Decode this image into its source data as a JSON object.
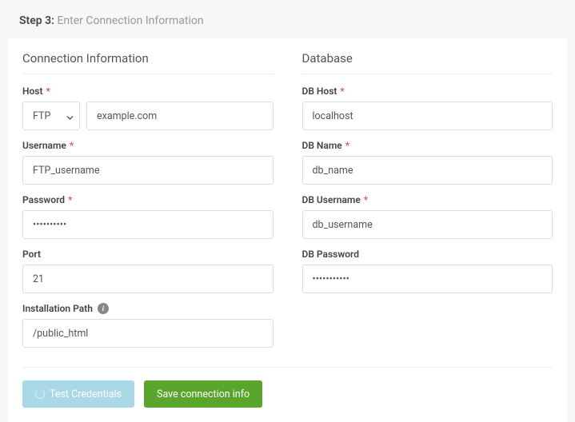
{
  "header": {
    "step": "Step 3:",
    "title": "Enter Connection Information"
  },
  "connection": {
    "section_title": "Connection Information",
    "host": {
      "label": "Host",
      "protocol": "FTP",
      "value": "example.com"
    },
    "username": {
      "label": "Username",
      "value": "FTP_username"
    },
    "password": {
      "label": "Password",
      "value": "••••••••••"
    },
    "port": {
      "label": "Port",
      "value": "21"
    },
    "install_path": {
      "label": "Installation Path",
      "value": "/public_html"
    }
  },
  "database": {
    "section_title": "Database",
    "host": {
      "label": "DB Host",
      "value": "localhost"
    },
    "name": {
      "label": "DB Name",
      "value": "db_name"
    },
    "username": {
      "label": "DB Username",
      "value": "db_username"
    },
    "password": {
      "label": "DB Password",
      "value": "•••••••••••"
    }
  },
  "buttons": {
    "test": "Test Credentials",
    "save": "Save connection info"
  }
}
